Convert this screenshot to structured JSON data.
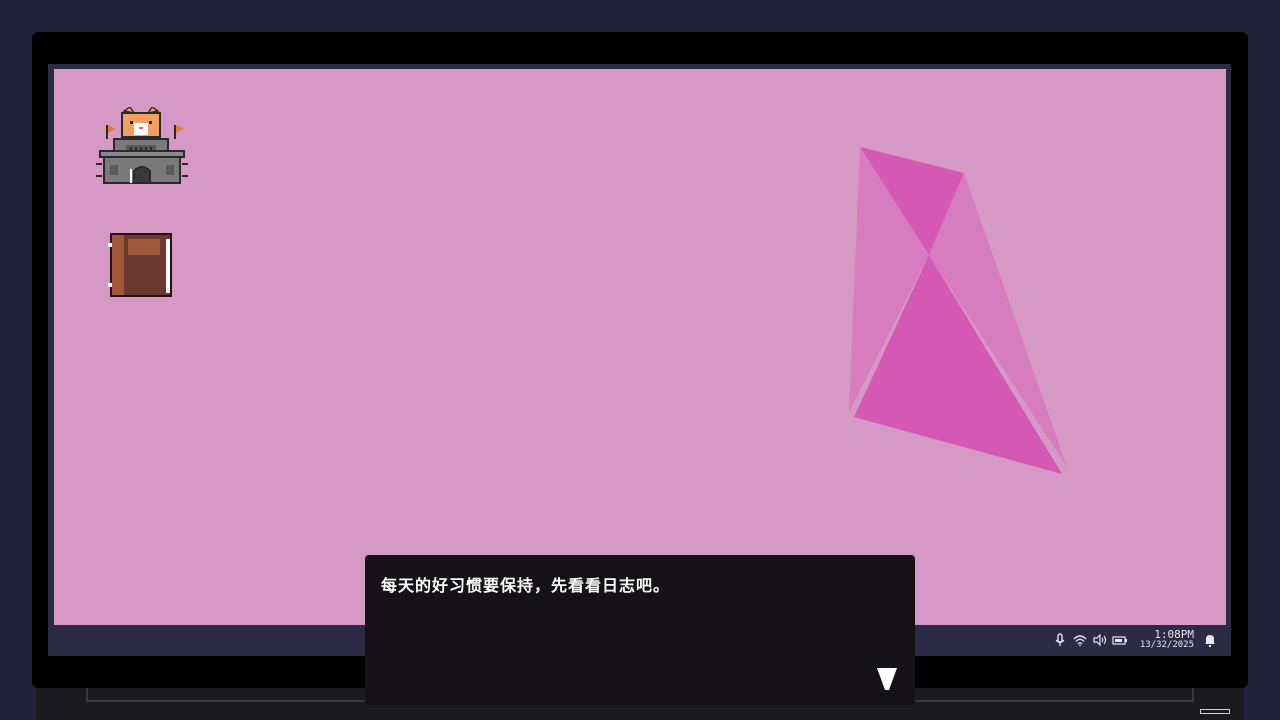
{
  "taskbar": {
    "tray_icons": [
      "microphone-icon",
      "wifi-icon",
      "volume-icon",
      "battery-icon"
    ],
    "time": "1:08PM",
    "date": "13/32/2025",
    "notification_icon": "bell-icon"
  },
  "desktop": {
    "icons": [
      "castle-cat-icon",
      "journal-book-icon"
    ],
    "background_color": "#d698c4",
    "crystal_color": "#d85cb4"
  },
  "dialog": {
    "text": "每天的好习惯要保持，先看看日志吧。",
    "advance_icon": "triangle-down-icon"
  }
}
